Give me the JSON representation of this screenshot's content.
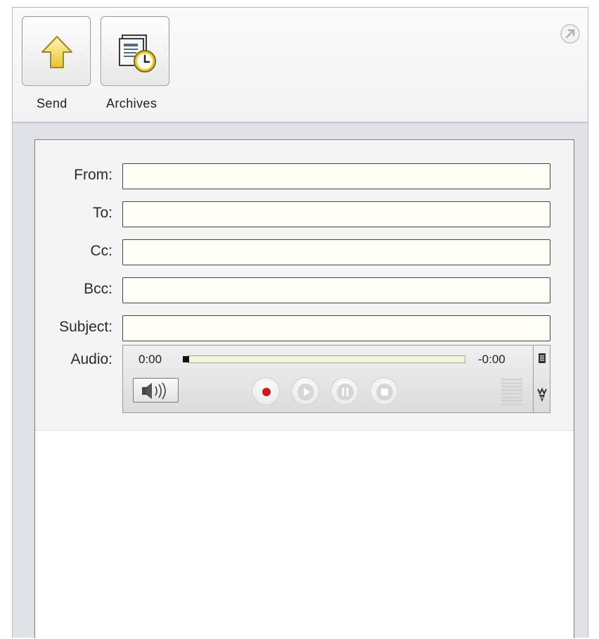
{
  "toolbar": {
    "send_label": "Send",
    "archives_label": "Archives",
    "send_icon": "up-arrow-icon",
    "archives_icon": "archive-clock-icon",
    "corner_icon": "expand-arrow-icon"
  },
  "form": {
    "from_label": "From:",
    "to_label": "To:",
    "cc_label": "Cc:",
    "bcc_label": "Bcc:",
    "subject_label": "Subject:",
    "audio_label": "Audio:",
    "from_value": "",
    "to_value": "",
    "cc_value": "",
    "bcc_value": "",
    "subject_value": ""
  },
  "audio": {
    "time_elapsed": "0:00",
    "time_remaining": "-0:00",
    "progress": 0,
    "controls": [
      "record-icon",
      "play-icon",
      "pause-icon",
      "stop-icon"
    ],
    "volume_icon": "speaker-icon",
    "side_icons": [
      "menu-icon",
      "chevron-grip-icon"
    ]
  },
  "message": {
    "body_value": ""
  },
  "colors": {
    "record_red": "#d01818",
    "field_background": "#fffff8",
    "progress_background": "#f3f5d8",
    "send_arrow": "#f2d44a",
    "clock_face": "#f5c928"
  }
}
